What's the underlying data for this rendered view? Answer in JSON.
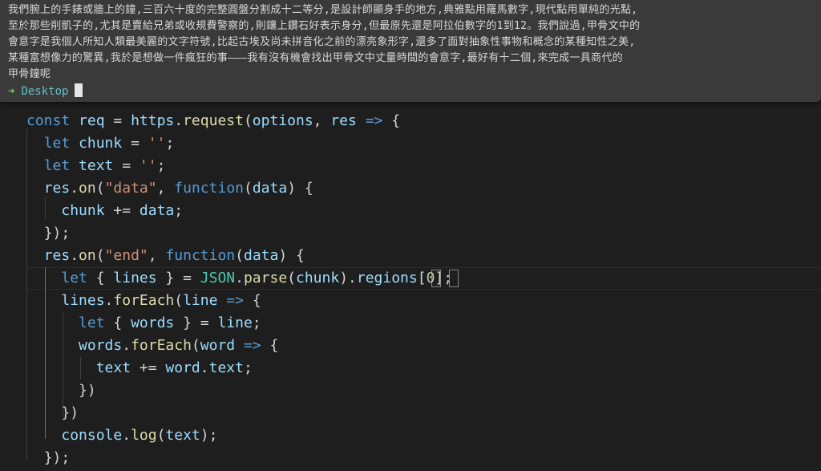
{
  "terminal": {
    "output_lines": [
      "我們腕上的手錶或牆上的鐘,三百六十度的完整圓盤分割成十二等分,是設計師顯身手的地方,典雅點用羅馬數字,現代點用單純的光點,",
      "至於那些削凱子的,尤其是賣給兄弟或收規費警察的,則鑲上鑽石好表示身分,但最原先還是阿拉伯數字的1到12。我們說過,甲骨文中的",
      "會意字是我個人所知人類最美麗的文字符號,比起古埃及尚未拼音化之前的漂亮象形字,還多了面對抽象性事物和概念的某種知性之美,",
      "某種富想像力的驚異,我於是想做一件瘋狂的事———我有沒有機會找出甲骨文中丈量時間的會意字,最好有十二個,來完成一具商代的",
      "甲骨鐘呢"
    ],
    "prompt_arrow": "➜",
    "prompt_directory": "Desktop"
  },
  "editor": {
    "lines": [
      {
        "indent": "",
        "tokens": [
          {
            "t": "const",
            "c": "kw"
          },
          {
            "t": " "
          },
          {
            "t": "req",
            "c": "var"
          },
          {
            "t": " = "
          },
          {
            "t": "https",
            "c": "var"
          },
          {
            "t": "."
          },
          {
            "t": "request",
            "c": "fn"
          },
          {
            "t": "("
          },
          {
            "t": "options",
            "c": "var"
          },
          {
            "t": ", "
          },
          {
            "t": "res",
            "c": "param"
          },
          {
            "t": " => ",
            "c": "kw"
          },
          {
            "t": "{"
          }
        ]
      },
      {
        "indent": "  ",
        "tokens": [
          {
            "t": "let",
            "c": "kw"
          },
          {
            "t": " "
          },
          {
            "t": "chunk",
            "c": "var"
          },
          {
            "t": " = "
          },
          {
            "t": "''",
            "c": "str"
          },
          {
            "t": ";"
          }
        ]
      },
      {
        "indent": "  ",
        "tokens": [
          {
            "t": "let",
            "c": "kw"
          },
          {
            "t": " "
          },
          {
            "t": "text",
            "c": "var"
          },
          {
            "t": " = "
          },
          {
            "t": "''",
            "c": "str"
          },
          {
            "t": ";"
          }
        ]
      },
      {
        "indent": "  ",
        "tokens": [
          {
            "t": "res",
            "c": "var"
          },
          {
            "t": "."
          },
          {
            "t": "on",
            "c": "fn"
          },
          {
            "t": "("
          },
          {
            "t": "\"data\"",
            "c": "str"
          },
          {
            "t": ", "
          },
          {
            "t": "function",
            "c": "kw"
          },
          {
            "t": "("
          },
          {
            "t": "data",
            "c": "param"
          },
          {
            "t": ") {"
          }
        ]
      },
      {
        "indent": "    ",
        "tokens": [
          {
            "t": "chunk",
            "c": "var"
          },
          {
            "t": " += "
          },
          {
            "t": "data",
            "c": "var"
          },
          {
            "t": ";"
          }
        ]
      },
      {
        "indent": "  ",
        "tokens": [
          {
            "t": "});"
          }
        ]
      },
      {
        "indent": "  ",
        "tokens": [
          {
            "t": "res",
            "c": "var"
          },
          {
            "t": "."
          },
          {
            "t": "on",
            "c": "fn"
          },
          {
            "t": "("
          },
          {
            "t": "\"end\"",
            "c": "str"
          },
          {
            "t": ", "
          },
          {
            "t": "function",
            "c": "kw"
          },
          {
            "t": "("
          },
          {
            "t": "data",
            "c": "param"
          },
          {
            "t": ") {"
          }
        ]
      },
      {
        "indent": "    ",
        "tokens": [
          {
            "t": "let",
            "c": "kw"
          },
          {
            "t": " { "
          },
          {
            "t": "lines",
            "c": "var"
          },
          {
            "t": " } = "
          },
          {
            "t": "JSON",
            "c": "cls"
          },
          {
            "t": "."
          },
          {
            "t": "parse",
            "c": "fn"
          },
          {
            "t": "("
          },
          {
            "t": "chunk",
            "c": "var"
          },
          {
            "t": ")."
          },
          {
            "t": "regions",
            "c": "var"
          },
          {
            "t": "["
          },
          {
            "t": "0",
            "c": "num"
          },
          {
            "t": "];"
          }
        ]
      },
      {
        "indent": "    ",
        "tokens": [
          {
            "t": "lines",
            "c": "var"
          },
          {
            "t": "."
          },
          {
            "t": "forEach",
            "c": "fn"
          },
          {
            "t": "("
          },
          {
            "t": "line",
            "c": "param"
          },
          {
            "t": " => ",
            "c": "kw"
          },
          {
            "t": "{"
          }
        ]
      },
      {
        "indent": "      ",
        "tokens": [
          {
            "t": "let",
            "c": "kw"
          },
          {
            "t": " { "
          },
          {
            "t": "words",
            "c": "var"
          },
          {
            "t": " } = "
          },
          {
            "t": "line",
            "c": "var"
          },
          {
            "t": ";"
          }
        ]
      },
      {
        "indent": "      ",
        "tokens": [
          {
            "t": "words",
            "c": "var"
          },
          {
            "t": "."
          },
          {
            "t": "forEach",
            "c": "fn"
          },
          {
            "t": "("
          },
          {
            "t": "word",
            "c": "param"
          },
          {
            "t": " => ",
            "c": "kw"
          },
          {
            "t": "{"
          }
        ]
      },
      {
        "indent": "        ",
        "tokens": [
          {
            "t": "text",
            "c": "var"
          },
          {
            "t": " += "
          },
          {
            "t": "word",
            "c": "var"
          },
          {
            "t": "."
          },
          {
            "t": "text",
            "c": "var"
          },
          {
            "t": ";"
          }
        ]
      },
      {
        "indent": "      ",
        "tokens": [
          {
            "t": "})"
          }
        ]
      },
      {
        "indent": "    ",
        "tokens": [
          {
            "t": "})"
          }
        ]
      },
      {
        "indent": "    ",
        "tokens": [
          {
            "t": "console",
            "c": "var"
          },
          {
            "t": "."
          },
          {
            "t": "log",
            "c": "fn"
          },
          {
            "t": "("
          },
          {
            "t": "text",
            "c": "var"
          },
          {
            "t": ");"
          }
        ]
      },
      {
        "indent": "  ",
        "tokens": [
          {
            "t": "});"
          }
        ]
      }
    ]
  }
}
